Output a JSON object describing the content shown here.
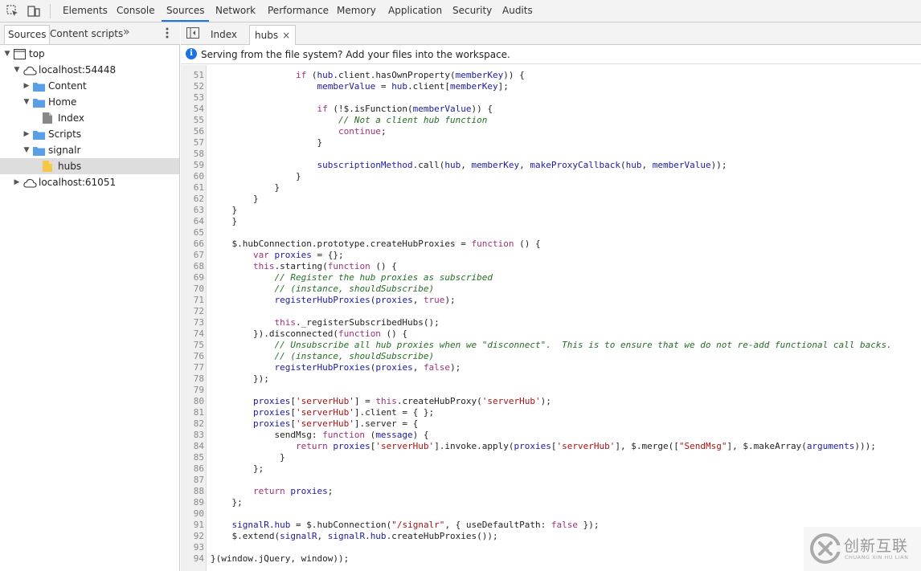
{
  "toolbar": {
    "inspect_icon": "element-picker-icon",
    "device_icon": "device-toolbar-icon",
    "tabs": [
      "Elements",
      "Console",
      "Sources",
      "Network",
      "Performance",
      "Memory",
      "Application",
      "Security",
      "Audits"
    ],
    "active_tab": "Sources"
  },
  "sidebar": {
    "tabs": [
      "Sources",
      "Content scripts"
    ],
    "active_tab": "Sources",
    "more_label": "»",
    "tree": [
      {
        "label": "top",
        "icon": "frame-icon",
        "expanded": true
      },
      {
        "label": "localhost:54448",
        "icon": "cloud-icon",
        "expanded": true
      },
      {
        "label": "Content",
        "icon": "folder-icon",
        "expanded": false
      },
      {
        "label": "Home",
        "icon": "folder-icon",
        "expanded": true
      },
      {
        "label": "Index",
        "icon": "file-icon"
      },
      {
        "label": "Scripts",
        "icon": "folder-icon",
        "expanded": false
      },
      {
        "label": "signalr",
        "icon": "folder-icon",
        "expanded": true
      },
      {
        "label": "hubs",
        "icon": "js-file-icon",
        "selected": true
      },
      {
        "label": "localhost:61051",
        "icon": "cloud-icon",
        "expanded": false
      }
    ]
  },
  "editor": {
    "tabs": [
      {
        "label": "Index",
        "active": false
      },
      {
        "label": "hubs",
        "active": true,
        "close": "×"
      }
    ],
    "info_message": "Serving from the file system? Add your files into the workspace.",
    "info_icon": "i",
    "lines": [
      {
        "n": "51",
        "code": "                if (hub.client.hasOwnProperty(memberKey)) {"
      },
      {
        "n": "52",
        "code": "                    memberValue = hub.client[memberKey];"
      },
      {
        "n": "53",
        "code": ""
      },
      {
        "n": "54",
        "code": "                    if (!$.isFunction(memberValue)) {"
      },
      {
        "n": "55",
        "code": "                        // Not a client hub function"
      },
      {
        "n": "56",
        "code": "                        continue;"
      },
      {
        "n": "57",
        "code": "                    }"
      },
      {
        "n": "58",
        "code": ""
      },
      {
        "n": "59",
        "code": "                    subscriptionMethod.call(hub, memberKey, makeProxyCallback(hub, memberValue));"
      },
      {
        "n": "60",
        "code": "                }"
      },
      {
        "n": "61",
        "code": "            }"
      },
      {
        "n": "62",
        "code": "        }"
      },
      {
        "n": "63",
        "code": "    }"
      },
      {
        "n": "64",
        "code": "    }"
      },
      {
        "n": "65",
        "code": ""
      },
      {
        "n": "66",
        "code": "    $.hubConnection.prototype.createHubProxies = function () {"
      },
      {
        "n": "67",
        "code": "        var proxies = {};"
      },
      {
        "n": "68",
        "code": "        this.starting(function () {"
      },
      {
        "n": "69",
        "code": "            // Register the hub proxies as subscribed"
      },
      {
        "n": "70",
        "code": "            // (instance, shouldSubscribe)"
      },
      {
        "n": "71",
        "code": "            registerHubProxies(proxies, true);"
      },
      {
        "n": "72",
        "code": ""
      },
      {
        "n": "73",
        "code": "            this._registerSubscribedHubs();"
      },
      {
        "n": "74",
        "code": "        }).disconnected(function () {"
      },
      {
        "n": "75",
        "code": "            // Unsubscribe all hub proxies when we \"disconnect\".  This is to ensure that we do not re-add functional call backs."
      },
      {
        "n": "76",
        "code": "            // (instance, shouldSubscribe)"
      },
      {
        "n": "77",
        "code": "            registerHubProxies(proxies, false);"
      },
      {
        "n": "78",
        "code": "        });"
      },
      {
        "n": "79",
        "code": ""
      },
      {
        "n": "80",
        "code": "        proxies['serverHub'] = this.createHubProxy('serverHub');"
      },
      {
        "n": "81",
        "code": "        proxies['serverHub'].client = { };"
      },
      {
        "n": "82",
        "code": "        proxies['serverHub'].server = {"
      },
      {
        "n": "83",
        "code": "            sendMsg: function (message) {"
      },
      {
        "n": "84",
        "code": "                return proxies['serverHub'].invoke.apply(proxies['serverHub'], $.merge([\"SendMsg\"], $.makeArray(arguments)));"
      },
      {
        "n": "85",
        "code": "             }"
      },
      {
        "n": "86",
        "code": "        };"
      },
      {
        "n": "87",
        "code": ""
      },
      {
        "n": "88",
        "code": "        return proxies;"
      },
      {
        "n": "89",
        "code": "    };"
      },
      {
        "n": "90",
        "code": ""
      },
      {
        "n": "91",
        "code": "    signalR.hub = $.hubConnection(\"/signalr\", { useDefaultPath: false });"
      },
      {
        "n": "92",
        "code": "    $.extend(signalR, signalR.hub.createHubProxies());"
      },
      {
        "n": "93",
        "code": ""
      },
      {
        "n": "94",
        "code": "}(window.jQuery, window));"
      }
    ]
  },
  "watermark": {
    "brand_cn": "创新互联",
    "brand_en": "CHUANG XIN HU LIAN"
  },
  "colors": {
    "accent": "#1a73e8",
    "keyword": "#a22f7c",
    "string": "#a11111",
    "comment": "#236e25",
    "identifier": "#1a1aa6"
  }
}
